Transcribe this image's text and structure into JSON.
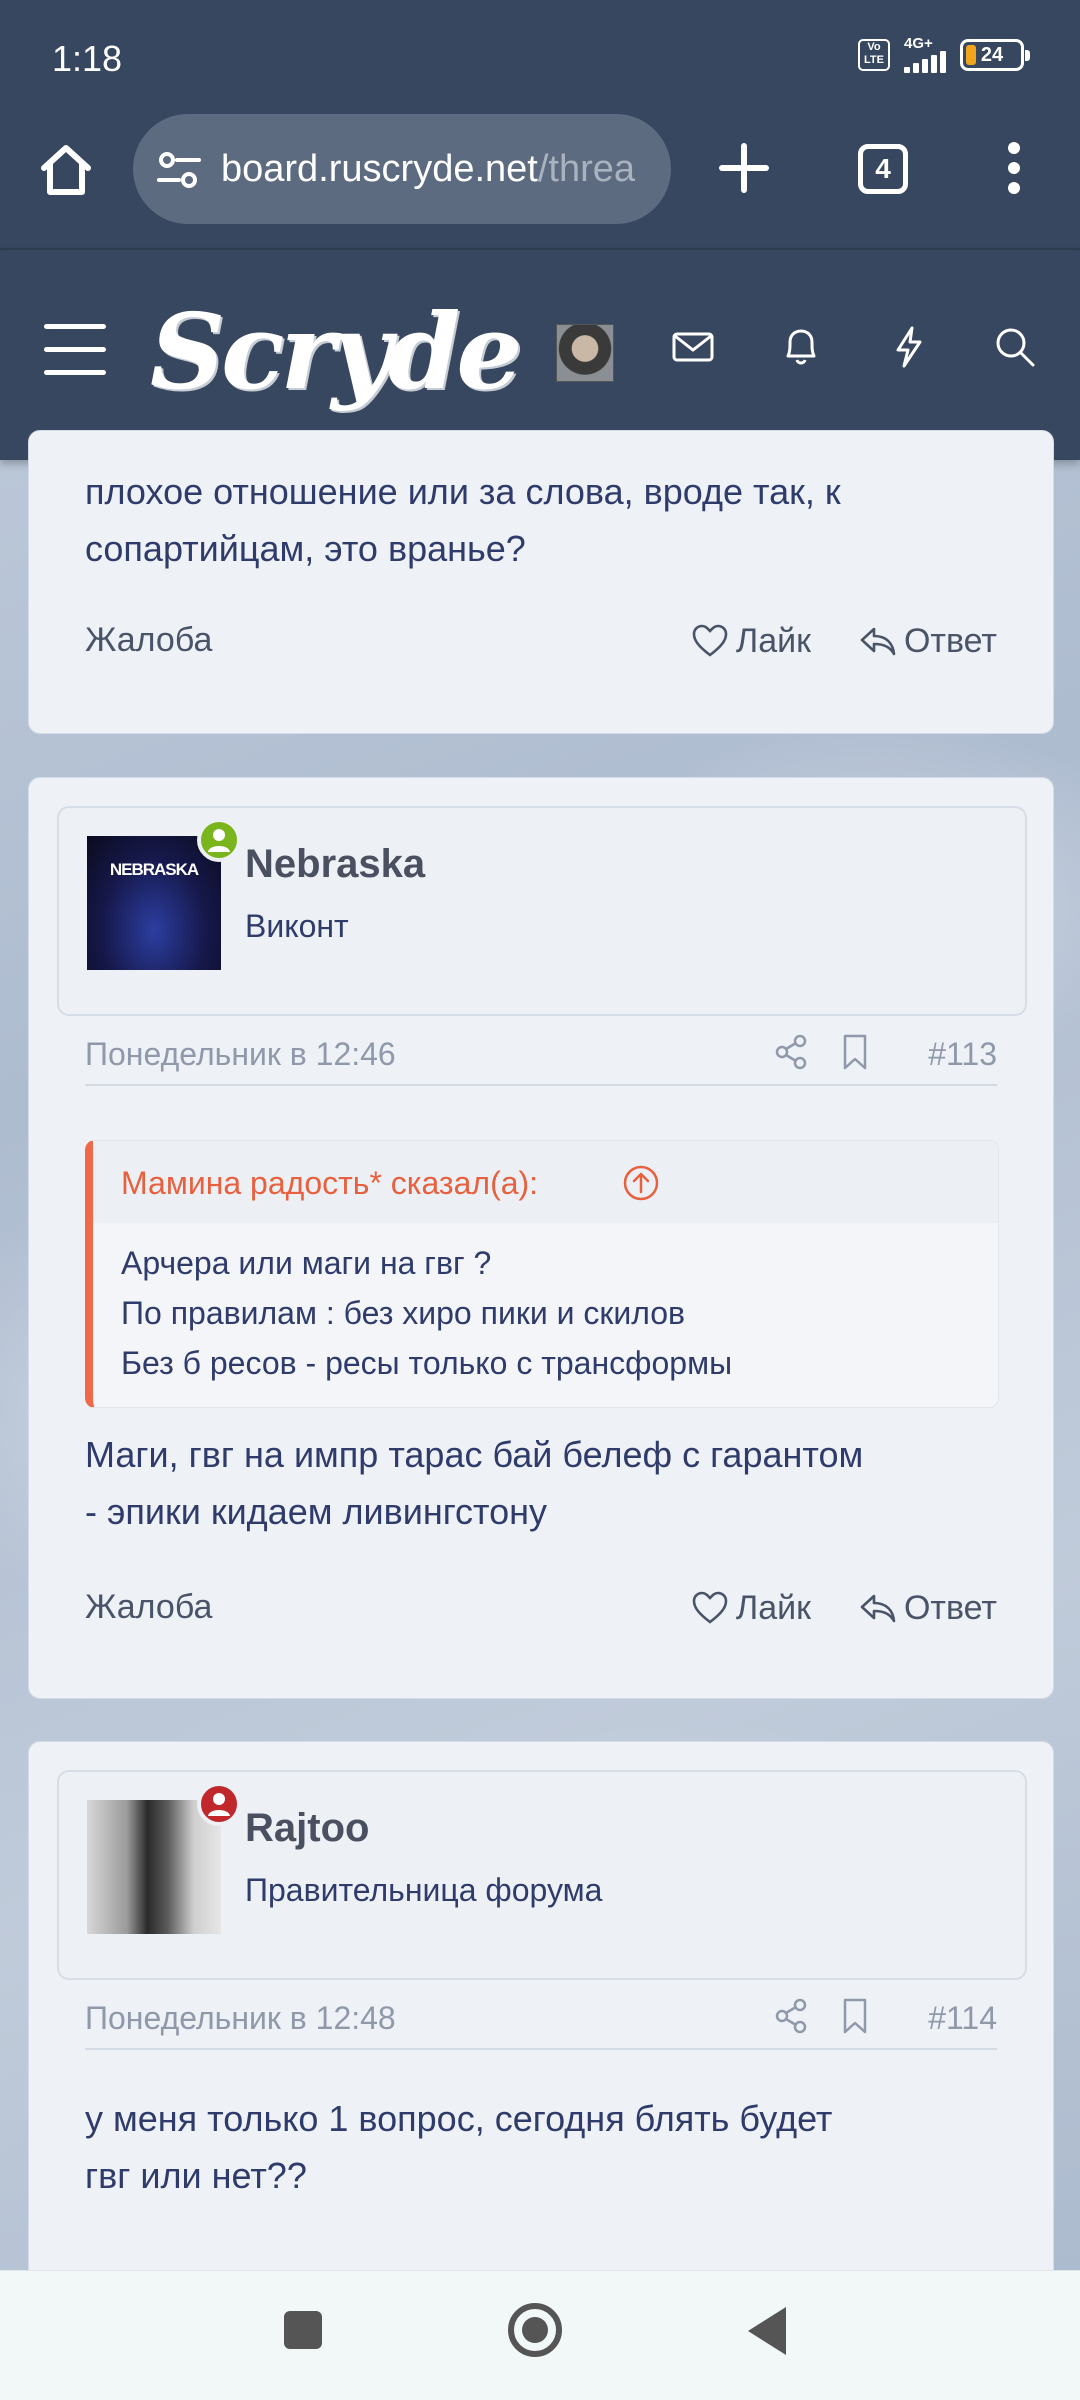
{
  "status_bar": {
    "time": "1:18",
    "network": "4G+",
    "volte": "Vo LTE",
    "battery": "24",
    "battery_color": "#f0a51d"
  },
  "browser": {
    "url_main": "board.ruscryde.net",
    "url_rest": "/threa",
    "tab_count": "4"
  },
  "site": {
    "logo": "Scryde"
  },
  "posts": [
    {
      "text_lines": [
        "плохое отношение или за слова, вроде так, к",
        "сопартийцам, это вранье?"
      ],
      "report": "Жалоба",
      "like": "Лайк",
      "reply": "Ответ"
    },
    {
      "username": "Nebraska",
      "user_title": "Виконт",
      "avatar_text": "NEBRASKA",
      "status_color": "#7ab51d",
      "date": "Понедельник в 12:46",
      "number": "#113",
      "quote": {
        "author": "Мамина радость* сказал(а):",
        "lines": [
          "Арчера или маги на гвг ?",
          "По правилам : без хиро пики и скилов",
          "Без б ресов - ресы только с трансформы"
        ]
      },
      "text_lines": [
        "Маги, гвг на импр тарас бай белеф с гарантом",
        "- эпики кидаем ливингстону"
      ],
      "report": "Жалоба",
      "like": "Лайк",
      "reply": "Ответ"
    },
    {
      "username": "Rajtoo",
      "user_title": "Правительница форума",
      "status_color": "#c0282c",
      "date": "Понедельник в 12:48",
      "number": "#114",
      "text_lines": [
        "у меня только 1 вопрос, сегодня блять будет",
        "гвг или нет??"
      ]
    }
  ]
}
